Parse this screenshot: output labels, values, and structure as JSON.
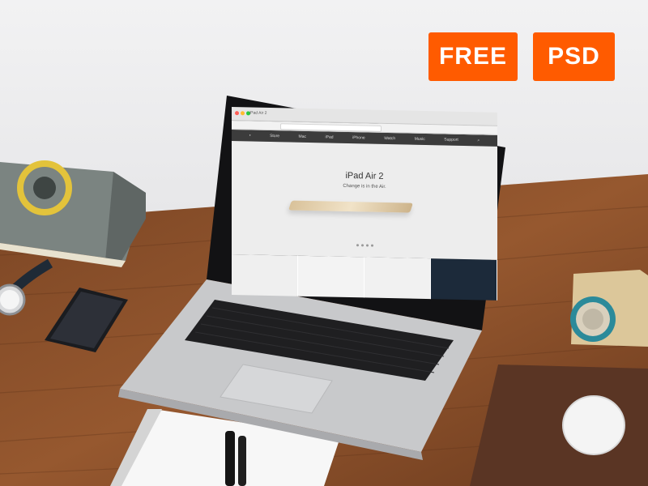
{
  "badges": {
    "free": "FREE",
    "psd": "PSD"
  },
  "colors": {
    "badge": "#ff5b00",
    "desk": "#8a4f2a",
    "laptop_body": "#c6c7c9",
    "screen_bezel": "#111111",
    "mousepad": "#5a3524",
    "book": "#7d8582"
  },
  "browser": {
    "tab_title": "iPad Air 2",
    "nav_items": [
      "",
      "Store",
      "Mac",
      "iPad",
      "iPhone",
      "Watch",
      "Music",
      "Support",
      ""
    ],
    "hero_title": "iPad Air 2",
    "hero_subtitle": "Change is in the Air."
  },
  "objects": [
    "laptop",
    "book",
    "wristwatch",
    "smartphone",
    "speaker",
    "mousepad",
    "mouse",
    "notebook",
    "pens"
  ]
}
